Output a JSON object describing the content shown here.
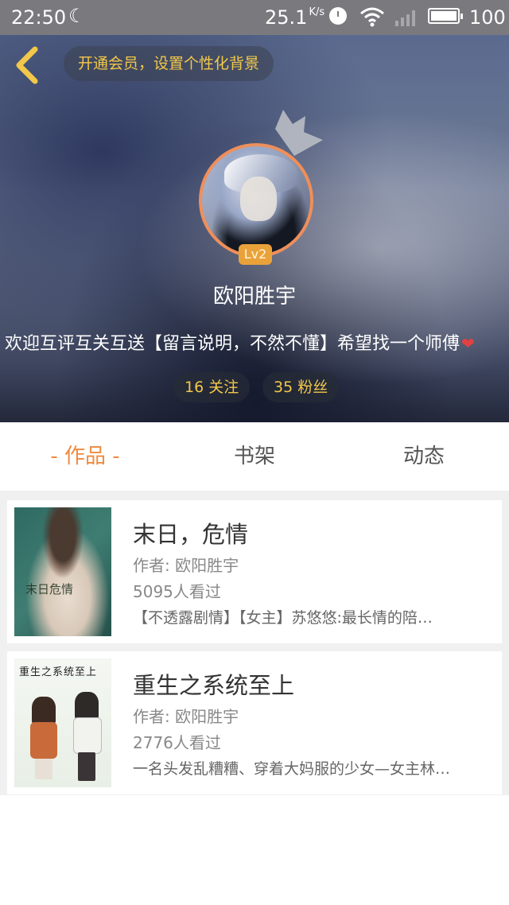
{
  "status_bar": {
    "time": "22:50",
    "speed": "25.1",
    "speed_unit": "K/s",
    "battery": "100"
  },
  "header": {
    "vip_prompt": "开通会员，设置个性化背景",
    "level": "Lv2",
    "username": "欧阳胜宇",
    "signature": "欢迎互评互关互送【留言说明，不然不懂】希望找一个师傅",
    "follow_stat": "16 关注",
    "fans_stat": "35 粉丝",
    "accent_color": "#f2c84a"
  },
  "tabs": [
    {
      "label": "- 作品 -",
      "active": true
    },
    {
      "label": "书架",
      "active": false
    },
    {
      "label": "动态",
      "active": false
    }
  ],
  "books": [
    {
      "title": "末日，危情",
      "author": "作者: 欧阳胜宇",
      "views": "5095人看过",
      "description": "【不透露剧情】【女主】苏悠悠:最长情的陪…",
      "cover_text": "末日危情"
    },
    {
      "title": "重生之系统至上",
      "author": "作者: 欧阳胜宇",
      "views": "2776人看过",
      "description": "一名头发乱糟糟、穿着大妈服的少女—女主林…",
      "cover_text": "重生之系统至上"
    }
  ],
  "colors": {
    "tab_active": "#ef8a3e",
    "avatar_ring": "#ef8f5a",
    "level_badge": "#e9a23a"
  }
}
